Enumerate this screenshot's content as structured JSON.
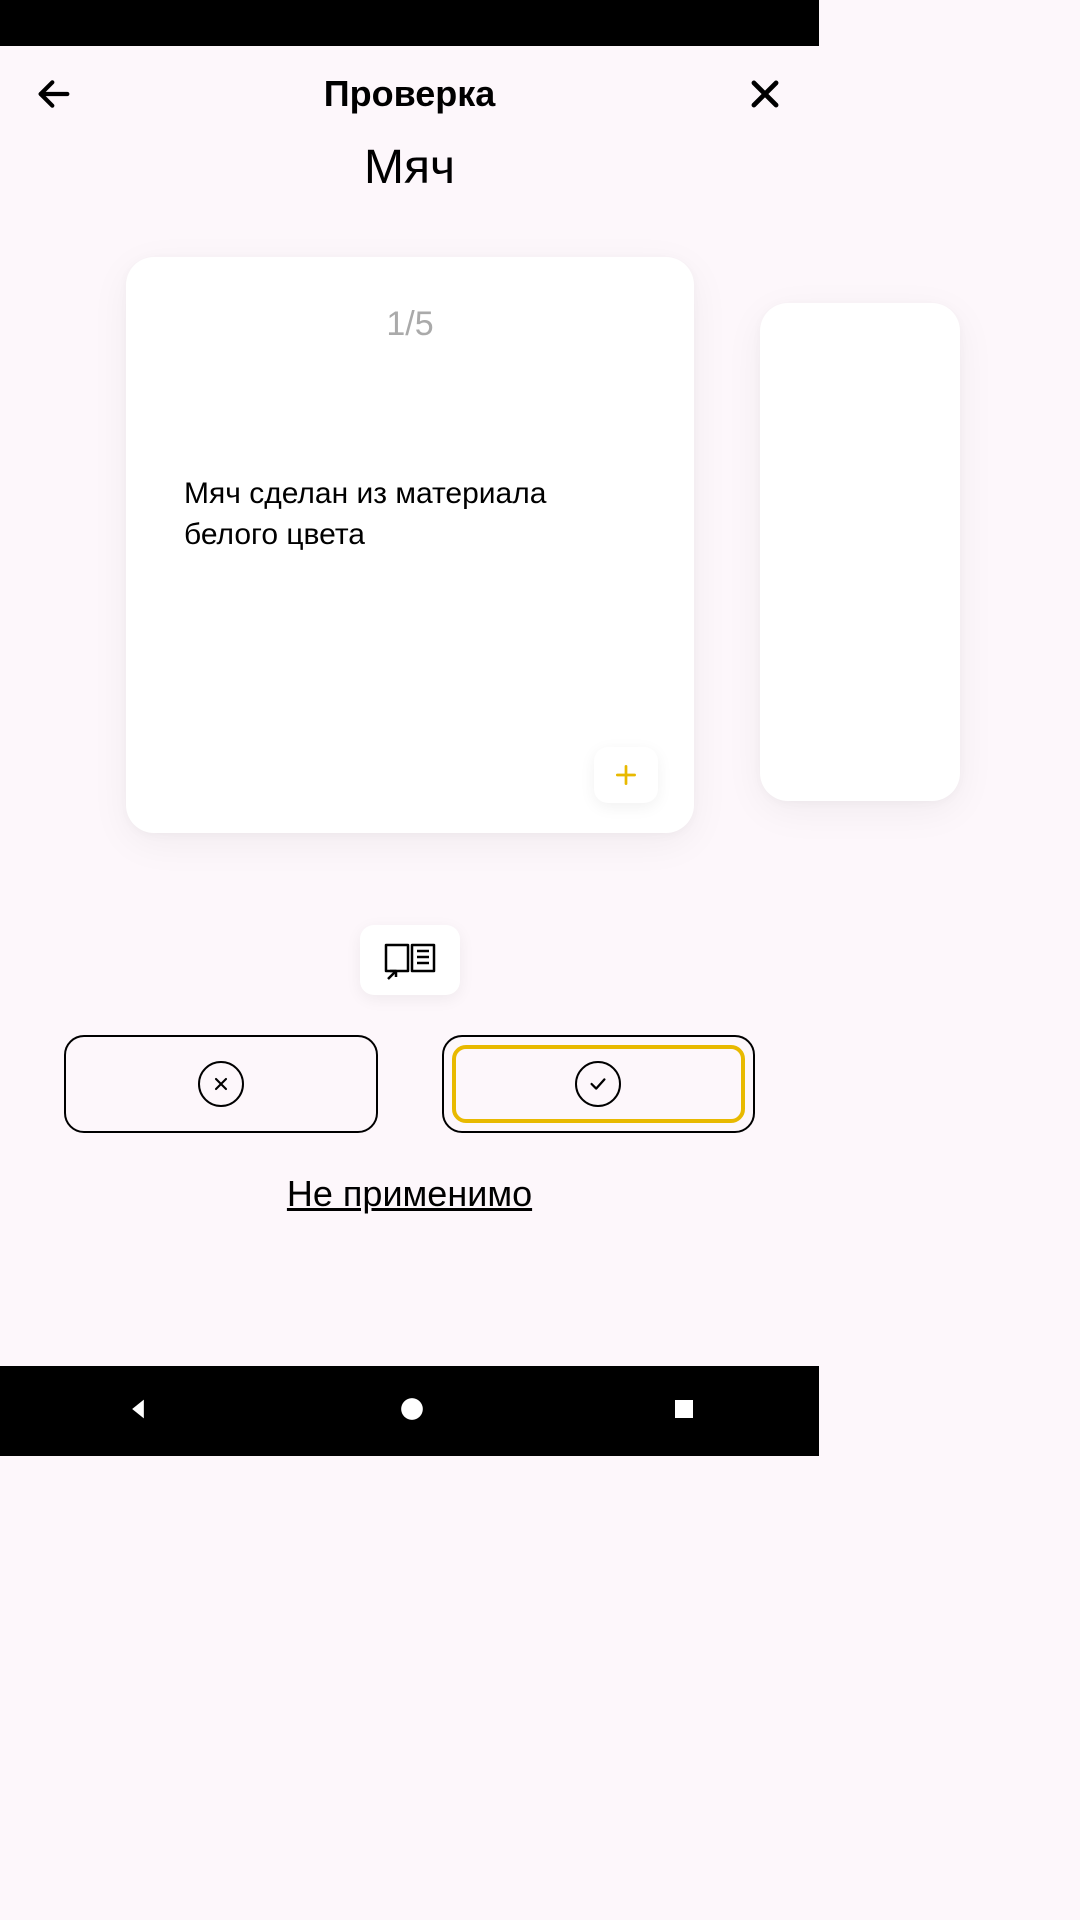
{
  "header": {
    "title": "Проверка"
  },
  "subtitle": "Мяч",
  "card": {
    "counter": "1/5",
    "text": "Мяч сделан из материала белого цвета"
  },
  "footer": {
    "not_applicable": "Не применимо"
  },
  "colors": {
    "accent": "#e8b900"
  }
}
